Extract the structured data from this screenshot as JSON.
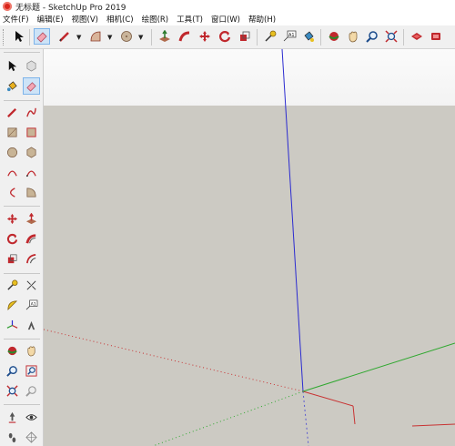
{
  "window": {
    "title": "无标题 - SketchUp Pro 2019"
  },
  "menu": [
    "文件(F)",
    "编辑(E)",
    "视图(V)",
    "相机(C)",
    "绘图(R)",
    "工具(T)",
    "窗口(W)",
    "帮助(H)"
  ],
  "toolbar": {
    "tools": [
      "select",
      "eraser",
      "line",
      "arc",
      "shape",
      "push-pull",
      "follow-me",
      "move",
      "rotate",
      "scale",
      "tape-measure",
      "text",
      "paint-bucket",
      "orbit",
      "pan",
      "zoom",
      "zoom-extents",
      "3d-warehouse",
      "extension-warehouse"
    ],
    "active": "eraser"
  },
  "left_toolbar": {
    "active": "eraser",
    "text_label": "A1"
  },
  "colors": {
    "ground": "#cccac3",
    "sky": "#f7f7f7",
    "blue_axis": "#2b2bd0",
    "red_axis": "#c83232",
    "green_axis": "#2fa82f"
  }
}
